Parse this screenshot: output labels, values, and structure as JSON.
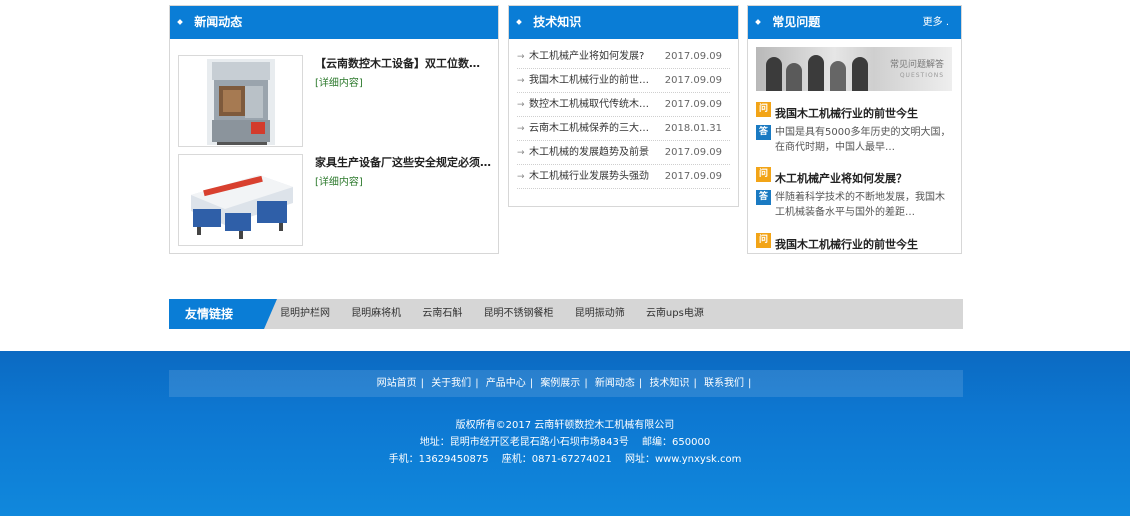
{
  "news": {
    "title": "新闻动态",
    "items": [
      {
        "title": "【云南数控木工设备】双工位数…",
        "more": "[详细内容]"
      },
      {
        "title": "家具生产设备厂这些安全规定必须…",
        "more": "[详细内容]"
      }
    ]
  },
  "tech": {
    "title": "技术知识",
    "items": [
      {
        "title": "木工机械产业将如何发展?",
        "date": "2017.09.09"
      },
      {
        "title": "我国木工机械行业的前世今…",
        "date": "2017.09.09"
      },
      {
        "title": "数控木工机械取代传统木工…",
        "date": "2017.09.09"
      },
      {
        "title": "云南木工机械保养的三大误…",
        "date": "2018.01.31"
      },
      {
        "title": "木工机械的发展趋势及前景",
        "date": "2017.09.09"
      },
      {
        "title": "木工机械行业发展势头强劲",
        "date": "2017.09.09"
      }
    ]
  },
  "faq": {
    "title": "常见问题",
    "more": "更多 .",
    "banner_title": "常见问题解答",
    "banner_sub": "QUESTIONS",
    "q_badge": "问",
    "a_badge": "答",
    "items": [
      {
        "q": "我国木工机械行业的前世今生",
        "a": "中国是具有5000多年历史的文明大国，在商代时期，中国人最早…"
      },
      {
        "q": "木工机械产业将如何发展？",
        "a": "伴随着科学技术的不断地发展，我国木工机械装备水平与国外的差距…"
      },
      {
        "q": "我国木工机械行业的前世今生",
        "a": ""
      }
    ]
  },
  "links": {
    "label": "友情链接",
    "items": [
      "昆明护栏网",
      "昆明麻将机",
      "云南石斛",
      "昆明不锈钢餐柜",
      "昆明振动筛",
      "云南ups电源"
    ]
  },
  "footer": {
    "nav": [
      "网站首页",
      "关于我们",
      "产品中心",
      "案例展示",
      "新闻动态",
      "技术知识",
      "联系我们"
    ],
    "sep": "|",
    "copyright": "版权所有©2017 云南轩顿数控木工机械有限公司",
    "address": "地址：昆明市经开区老昆石路小石坝市场843号",
    "zip": "邮编：650000",
    "mobile": "手机：13629450875",
    "phone": "座机：0871-67274021",
    "website": "网址：www.ynxysk.com"
  }
}
